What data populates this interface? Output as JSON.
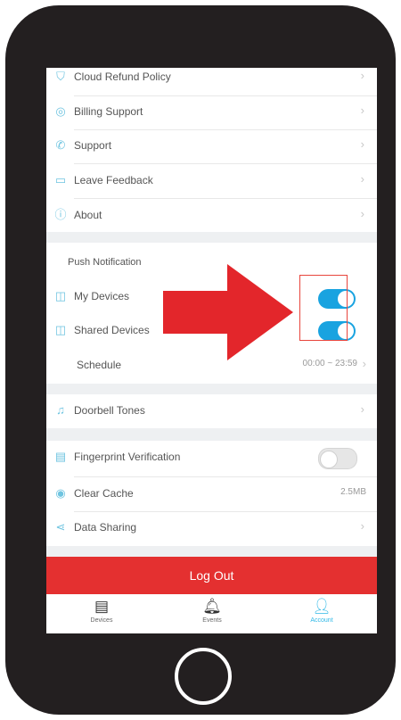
{
  "settings": {
    "group1": [
      {
        "label": "Cloud Refund Policy",
        "icon": "shield-icon"
      },
      {
        "label": "Billing Support",
        "icon": "coin-icon"
      },
      {
        "label": "Support",
        "icon": "phone-icon"
      },
      {
        "label": "Leave Feedback",
        "icon": "feedback-icon"
      },
      {
        "label": "About",
        "icon": "info-icon"
      }
    ],
    "push_notification": {
      "header": "Push Notification",
      "my_devices": "My Devices",
      "my_devices_on": true,
      "shared_devices": "Shared Devices",
      "shared_devices_on": true,
      "schedule_label": "Schedule",
      "schedule_value": "00:00 ~ 23:59"
    },
    "doorbell_tones": "Doorbell Tones",
    "group3": {
      "fingerprint": "Fingerprint Verification",
      "fingerprint_on": false,
      "clear_cache": "Clear Cache",
      "cache_size": "2.5MB",
      "data_sharing": "Data Sharing"
    }
  },
  "logout_label": "Log Out",
  "tabs": [
    {
      "label": "Devices",
      "icon": "devices-icon"
    },
    {
      "label": "Events",
      "icon": "bell-icon"
    },
    {
      "label": "Account",
      "icon": "account-icon",
      "active": true
    }
  ],
  "colors": {
    "accent": "#19a3e0",
    "logout": "#e43030",
    "arrow": "#e3262b",
    "phone_body": "#231f20"
  }
}
